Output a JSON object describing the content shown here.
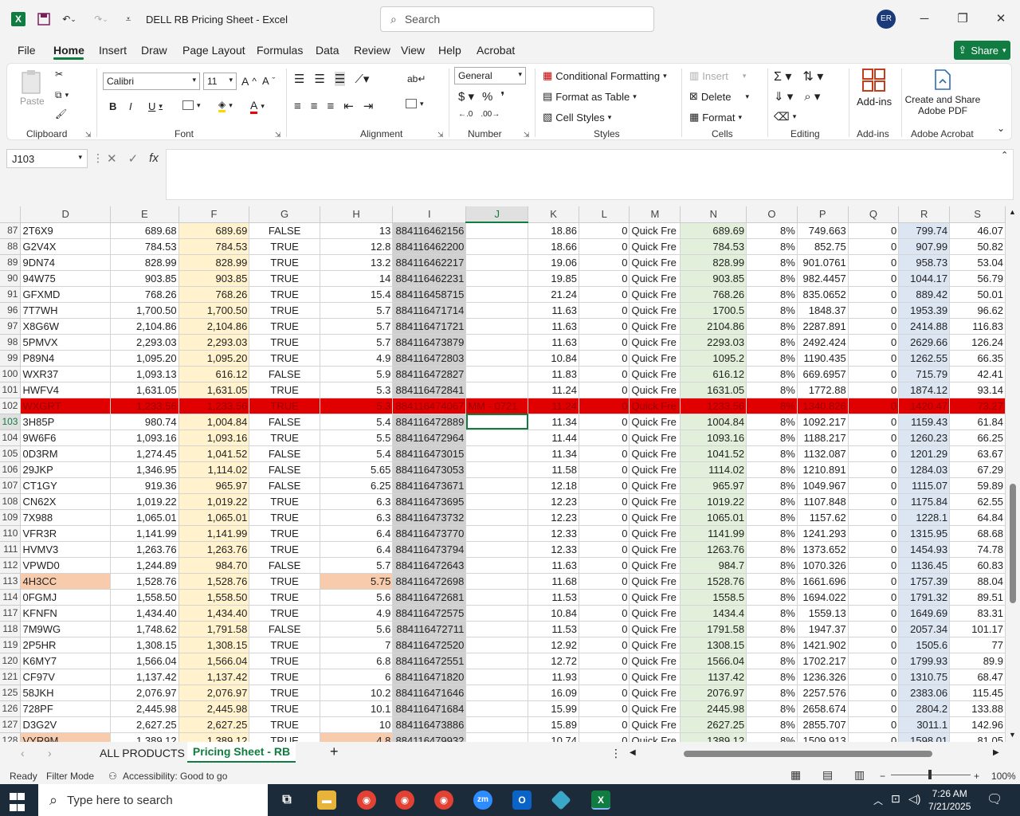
{
  "app": {
    "title": "DELL RB Pricing Sheet  -  Excel",
    "user_initials": "ER"
  },
  "search": {
    "placeholder": "Search"
  },
  "menu": [
    "File",
    "Home",
    "Insert",
    "Draw",
    "Page Layout",
    "Formulas",
    "Data",
    "Review",
    "View",
    "Help",
    "Acrobat"
  ],
  "share_label": "Share",
  "ribbon": {
    "clipboard": {
      "paste": "Paste",
      "label": "Clipboard"
    },
    "font": {
      "name": "Calibri",
      "size": "11",
      "label": "Font"
    },
    "alignment": {
      "label": "Alignment"
    },
    "number": {
      "format": "General",
      "label": "Number"
    },
    "styles": {
      "conditional": "Conditional Formatting",
      "format_table": "Format as Table",
      "cell_styles": "Cell Styles",
      "label": "Styles"
    },
    "cells": {
      "insert": "Insert",
      "delete": "Delete",
      "format": "Format",
      "label": "Cells"
    },
    "editing": {
      "label": "Editing"
    },
    "addins": {
      "button": "Add-ins",
      "label": "Add-ins"
    },
    "acrobat": {
      "button": "Create and Share Adobe PDF",
      "label": "Adobe Acrobat"
    }
  },
  "formula_bar": {
    "name_box": "J103",
    "formula": ""
  },
  "columns": [
    "D",
    "E",
    "F",
    "G",
    "H",
    "I",
    "J",
    "K",
    "L",
    "M",
    "N",
    "O",
    "P",
    "Q",
    "R",
    "S"
  ],
  "rows": [
    {
      "n": "87",
      "d": "2T6X9",
      "e": "689.68",
      "f": "689.69",
      "g": "FALSE",
      "h": "13",
      "i": "884116462156",
      "j": "",
      "k": "18.86",
      "l": "0",
      "m": "Quick Fre",
      "nv": "689.69",
      "o": "8%",
      "p": "749.663",
      "q": "0",
      "r": "799.74",
      "s": "46.07"
    },
    {
      "n": "88",
      "d": "G2V4X",
      "e": "784.53",
      "f": "784.53",
      "g": "TRUE",
      "h": "12.8",
      "i": "884116462200",
      "j": "",
      "k": "18.66",
      "l": "0",
      "m": "Quick Fre",
      "nv": "784.53",
      "o": "8%",
      "p": "852.75",
      "q": "0",
      "r": "907.99",
      "s": "50.82"
    },
    {
      "n": "89",
      "d": "9DN74",
      "e": "828.99",
      "f": "828.99",
      "g": "TRUE",
      "h": "13.2",
      "i": "884116462217",
      "j": "",
      "k": "19.06",
      "l": "0",
      "m": "Quick Fre",
      "nv": "828.99",
      "o": "8%",
      "p": "901.0761",
      "q": "0",
      "r": "958.73",
      "s": "53.04"
    },
    {
      "n": "90",
      "d": "94W75",
      "e": "903.85",
      "f": "903.85",
      "g": "TRUE",
      "h": "14",
      "i": "884116462231",
      "j": "",
      "k": "19.85",
      "l": "0",
      "m": "Quick Fre",
      "nv": "903.85",
      "o": "8%",
      "p": "982.4457",
      "q": "0",
      "r": "1044.17",
      "s": "56.79"
    },
    {
      "n": "91",
      "d": "GFXMD",
      "e": "768.26",
      "f": "768.26",
      "g": "TRUE",
      "h": "15.4",
      "i": "884116458715",
      "j": "",
      "k": "21.24",
      "l": "0",
      "m": "Quick Fre",
      "nv": "768.26",
      "o": "8%",
      "p": "835.0652",
      "q": "0",
      "r": "889.42",
      "s": "50.01"
    },
    {
      "n": "96",
      "d": "7T7WH",
      "e": "1,700.50",
      "f": "1,700.50",
      "g": "TRUE",
      "h": "5.7",
      "i": "884116471714",
      "j": "",
      "k": "11.63",
      "l": "0",
      "m": "Quick Fre",
      "nv": "1700.5",
      "o": "8%",
      "p": "1848.37",
      "q": "0",
      "r": "1953.39",
      "s": "96.62"
    },
    {
      "n": "97",
      "d": "X8G6W",
      "e": "2,104.86",
      "f": "2,104.86",
      "g": "TRUE",
      "h": "5.7",
      "i": "884116471721",
      "j": "",
      "k": "11.63",
      "l": "0",
      "m": "Quick Fre",
      "nv": "2104.86",
      "o": "8%",
      "p": "2287.891",
      "q": "0",
      "r": "2414.88",
      "s": "116.83"
    },
    {
      "n": "98",
      "d": "5PMVX",
      "e": "2,293.03",
      "f": "2,293.03",
      "g": "TRUE",
      "h": "5.7",
      "i": "884116473879",
      "j": "",
      "k": "11.63",
      "l": "0",
      "m": "Quick Fre",
      "nv": "2293.03",
      "o": "8%",
      "p": "2492.424",
      "q": "0",
      "r": "2629.66",
      "s": "126.24"
    },
    {
      "n": "99",
      "d": "P89N4",
      "e": "1,095.20",
      "f": "1,095.20",
      "g": "TRUE",
      "h": "4.9",
      "i": "884116472803",
      "j": "",
      "k": "10.84",
      "l": "0",
      "m": "Quick Fre",
      "nv": "1095.2",
      "o": "8%",
      "p": "1190.435",
      "q": "0",
      "r": "1262.55",
      "s": "66.35"
    },
    {
      "n": "100",
      "d": "WXR37",
      "e": "1,093.13",
      "f": "616.12",
      "g": "FALSE",
      "h": "5.9",
      "i": "884116472827",
      "j": "",
      "k": "11.83",
      "l": "0",
      "m": "Quick Fre",
      "nv": "616.12",
      "o": "8%",
      "p": "669.6957",
      "q": "0",
      "r": "715.79",
      "s": "42.41"
    },
    {
      "n": "101",
      "d": "HWFV4",
      "e": "1,631.05",
      "f": "1,631.05",
      "g": "TRUE",
      "h": "5.3",
      "i": "884116472841",
      "j": "",
      "k": "11.24",
      "l": "0",
      "m": "Quick Fre",
      "nv": "1631.05",
      "o": "8%",
      "p": "1772.88",
      "q": "0",
      "r": "1874.12",
      "s": "93.14"
    },
    {
      "n": "102",
      "d": "WXGRT",
      "e": "1,233.56",
      "f": "1,233.56",
      "g": "TRUE",
      "h": "5.3",
      "i": "884116474067",
      "j": "MM - 0721",
      "k": "11.24",
      "l": "0",
      "m": "Quick Fre",
      "nv": "1233.56",
      "o": "8%",
      "p": "1340.826",
      "q": "0",
      "r": "1420.47",
      "s": "73.27"
    },
    {
      "n": "103",
      "d": "3H85P",
      "e": "980.74",
      "f": "1,004.84",
      "g": "FALSE",
      "h": "5.4",
      "i": "884116472889",
      "j": "",
      "k": "11.34",
      "l": "0",
      "m": "Quick Fre",
      "nv": "1004.84",
      "o": "8%",
      "p": "1092.217",
      "q": "0",
      "r": "1159.43",
      "s": "61.84"
    },
    {
      "n": "104",
      "d": "9W6F6",
      "e": "1,093.16",
      "f": "1,093.16",
      "g": "TRUE",
      "h": "5.5",
      "i": "884116472964",
      "j": "",
      "k": "11.44",
      "l": "0",
      "m": "Quick Fre",
      "nv": "1093.16",
      "o": "8%",
      "p": "1188.217",
      "q": "0",
      "r": "1260.23",
      "s": "66.25"
    },
    {
      "n": "105",
      "d": "0D3RM",
      "e": "1,274.45",
      "f": "1,041.52",
      "g": "FALSE",
      "h": "5.4",
      "i": "884116473015",
      "j": "",
      "k": "11.34",
      "l": "0",
      "m": "Quick Fre",
      "nv": "1041.52",
      "o": "8%",
      "p": "1132.087",
      "q": "0",
      "r": "1201.29",
      "s": "63.67"
    },
    {
      "n": "106",
      "d": "29JKP",
      "e": "1,346.95",
      "f": "1,114.02",
      "g": "FALSE",
      "h": "5.65",
      "i": "884116473053",
      "j": "",
      "k": "11.58",
      "l": "0",
      "m": "Quick Fre",
      "nv": "1114.02",
      "o": "8%",
      "p": "1210.891",
      "q": "0",
      "r": "1284.03",
      "s": "67.29"
    },
    {
      "n": "107",
      "d": "CT1GY",
      "e": "919.36",
      "f": "965.97",
      "g": "FALSE",
      "h": "6.25",
      "i": "884116473671",
      "j": "",
      "k": "12.18",
      "l": "0",
      "m": "Quick Fre",
      "nv": "965.97",
      "o": "8%",
      "p": "1049.967",
      "q": "0",
      "r": "1115.07",
      "s": "59.89"
    },
    {
      "n": "108",
      "d": "CN62X",
      "e": "1,019.22",
      "f": "1,019.22",
      "g": "TRUE",
      "h": "6.3",
      "i": "884116473695",
      "j": "",
      "k": "12.23",
      "l": "0",
      "m": "Quick Fre",
      "nv": "1019.22",
      "o": "8%",
      "p": "1107.848",
      "q": "0",
      "r": "1175.84",
      "s": "62.55"
    },
    {
      "n": "109",
      "d": "7X988",
      "e": "1,065.01",
      "f": "1,065.01",
      "g": "TRUE",
      "h": "6.3",
      "i": "884116473732",
      "j": "",
      "k": "12.23",
      "l": "0",
      "m": "Quick Fre",
      "nv": "1065.01",
      "o": "8%",
      "p": "1157.62",
      "q": "0",
      "r": "1228.1",
      "s": "64.84"
    },
    {
      "n": "110",
      "d": "VFR3R",
      "e": "1,141.99",
      "f": "1,141.99",
      "g": "TRUE",
      "h": "6.4",
      "i": "884116473770",
      "j": "",
      "k": "12.33",
      "l": "0",
      "m": "Quick Fre",
      "nv": "1141.99",
      "o": "8%",
      "p": "1241.293",
      "q": "0",
      "r": "1315.95",
      "s": "68.68"
    },
    {
      "n": "111",
      "d": "HVMV3",
      "e": "1,263.76",
      "f": "1,263.76",
      "g": "TRUE",
      "h": "6.4",
      "i": "884116473794",
      "j": "",
      "k": "12.33",
      "l": "0",
      "m": "Quick Fre",
      "nv": "1263.76",
      "o": "8%",
      "p": "1373.652",
      "q": "0",
      "r": "1454.93",
      "s": "74.78"
    },
    {
      "n": "112",
      "d": "VPWD0",
      "e": "1,244.89",
      "f": "984.70",
      "g": "FALSE",
      "h": "5.7",
      "i": "884116472643",
      "j": "",
      "k": "11.63",
      "l": "0",
      "m": "Quick Fre",
      "nv": "984.7",
      "o": "8%",
      "p": "1070.326",
      "q": "0",
      "r": "1136.45",
      "s": "60.83"
    },
    {
      "n": "113",
      "d": "4H3CC",
      "e": "1,528.76",
      "f": "1,528.76",
      "g": "TRUE",
      "h": "5.75",
      "i": "884116472698",
      "j": "",
      "k": "11.68",
      "l": "0",
      "m": "Quick Fre",
      "nv": "1528.76",
      "o": "8%",
      "p": "1661.696",
      "q": "0",
      "r": "1757.39",
      "s": "88.04"
    },
    {
      "n": "114",
      "d": "0FGMJ",
      "e": "1,558.50",
      "f": "1,558.50",
      "g": "TRUE",
      "h": "5.6",
      "i": "884116472681",
      "j": "",
      "k": "11.53",
      "l": "0",
      "m": "Quick Fre",
      "nv": "1558.5",
      "o": "8%",
      "p": "1694.022",
      "q": "0",
      "r": "1791.32",
      "s": "89.51"
    },
    {
      "n": "117",
      "d": "KFNFN",
      "e": "1,434.40",
      "f": "1,434.40",
      "g": "TRUE",
      "h": "4.9",
      "i": "884116472575",
      "j": "",
      "k": "10.84",
      "l": "0",
      "m": "Quick Fre",
      "nv": "1434.4",
      "o": "8%",
      "p": "1559.13",
      "q": "0",
      "r": "1649.69",
      "s": "83.31"
    },
    {
      "n": "118",
      "d": "7M9WG",
      "e": "1,748.62",
      "f": "1,791.58",
      "g": "FALSE",
      "h": "5.6",
      "i": "884116472711",
      "j": "",
      "k": "11.53",
      "l": "0",
      "m": "Quick Fre",
      "nv": "1791.58",
      "o": "8%",
      "p": "1947.37",
      "q": "0",
      "r": "2057.34",
      "s": "101.17"
    },
    {
      "n": "119",
      "d": "2P5HR",
      "e": "1,308.15",
      "f": "1,308.15",
      "g": "TRUE",
      "h": "7",
      "i": "884116472520",
      "j": "",
      "k": "12.92",
      "l": "0",
      "m": "Quick Fre",
      "nv": "1308.15",
      "o": "8%",
      "p": "1421.902",
      "q": "0",
      "r": "1505.6",
      "s": "77"
    },
    {
      "n": "120",
      "d": "K6MY7",
      "e": "1,566.04",
      "f": "1,566.04",
      "g": "TRUE",
      "h": "6.8",
      "i": "884116472551",
      "j": "",
      "k": "12.72",
      "l": "0",
      "m": "Quick Fre",
      "nv": "1566.04",
      "o": "8%",
      "p": "1702.217",
      "q": "0",
      "r": "1799.93",
      "s": "89.9"
    },
    {
      "n": "121",
      "d": "CF97V",
      "e": "1,137.42",
      "f": "1,137.42",
      "g": "TRUE",
      "h": "6",
      "i": "884116471820",
      "j": "",
      "k": "11.93",
      "l": "0",
      "m": "Quick Fre",
      "nv": "1137.42",
      "o": "8%",
      "p": "1236.326",
      "q": "0",
      "r": "1310.75",
      "s": "68.47"
    },
    {
      "n": "125",
      "d": "58JKH",
      "e": "2,076.97",
      "f": "2,076.97",
      "g": "TRUE",
      "h": "10.2",
      "i": "884116471646",
      "j": "",
      "k": "16.09",
      "l": "0",
      "m": "Quick Fre",
      "nv": "2076.97",
      "o": "8%",
      "p": "2257.576",
      "q": "0",
      "r": "2383.06",
      "s": "115.45"
    },
    {
      "n": "126",
      "d": "728PF",
      "e": "2,445.98",
      "f": "2,445.98",
      "g": "TRUE",
      "h": "10.1",
      "i": "884116471684",
      "j": "",
      "k": "15.99",
      "l": "0",
      "m": "Quick Fre",
      "nv": "2445.98",
      "o": "8%",
      "p": "2658.674",
      "q": "0",
      "r": "2804.2",
      "s": "133.88"
    },
    {
      "n": "127",
      "d": "D3G2V",
      "e": "2,627.25",
      "f": "2,627.25",
      "g": "TRUE",
      "h": "10",
      "i": "884116473886",
      "j": "",
      "k": "15.89",
      "l": "0",
      "m": "Quick Fre",
      "nv": "2627.25",
      "o": "8%",
      "p": "2855.707",
      "q": "0",
      "r": "3011.1",
      "s": "142.96"
    },
    {
      "n": "128",
      "d": "VYR9M",
      "e": "1,389.12",
      "f": "1,389.12",
      "g": "TRUE",
      "h": "4.8",
      "i": "884116479932",
      "j": "",
      "k": "10.74",
      "l": "0",
      "m": "Quick Fre",
      "nv": "1389.12",
      "o": "8%",
      "p": "1509.913",
      "q": "0",
      "r": "1598.01",
      "s": "81.05"
    }
  ],
  "sheets": {
    "all_products": "ALL PRODUCTS",
    "active": "Pricing Sheet - RB"
  },
  "status": {
    "ready": "Ready",
    "filter": "Filter Mode",
    "accessibility": "Accessibility: Good to go",
    "zoom": "100%"
  },
  "taskbar": {
    "search_placeholder": "Type here to search",
    "time": "7:26 AM",
    "date": "7/21/2025"
  }
}
